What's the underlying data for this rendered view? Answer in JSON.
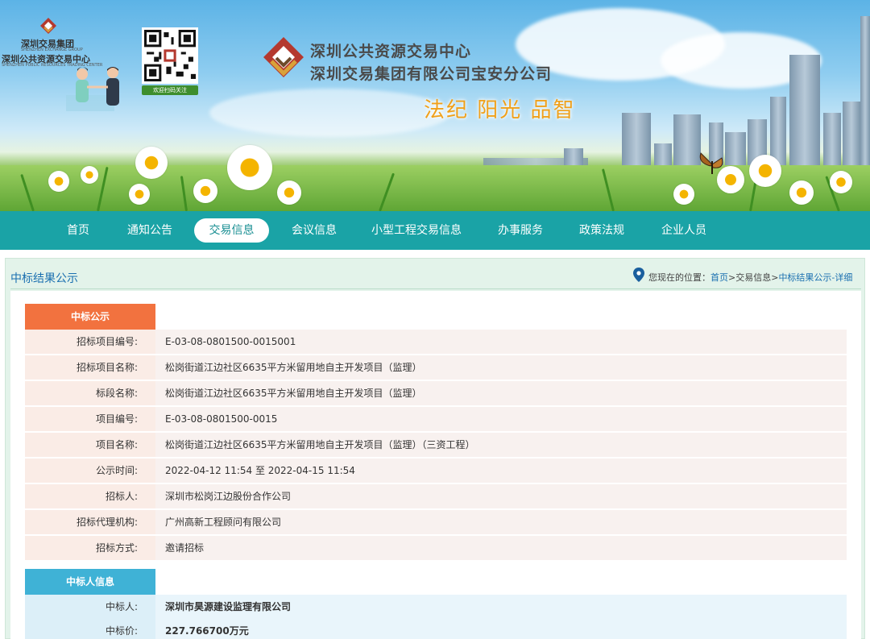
{
  "header": {
    "group_name": "深圳交易集团",
    "group_name_en": "SHENZHEN EXCHANGE GROUP",
    "center_name": "深圳公共资源交易中心",
    "center_name_en": "SHENZHEN PUBLIC RESOURCES TRADING CENTER",
    "qr_caption": "欢迎扫码关注",
    "org_line1": "深圳公共资源交易中心",
    "org_line2": "深圳交易集团有限公司宝安分公司",
    "slogan": "法纪  阳光  品智"
  },
  "nav": {
    "items": [
      {
        "label": "首页"
      },
      {
        "label": "通知公告"
      },
      {
        "label": "交易信息"
      },
      {
        "label": "会议信息"
      },
      {
        "label": "小型工程交易信息"
      },
      {
        "label": "办事服务"
      },
      {
        "label": "政策法规"
      },
      {
        "label": "企业人员"
      }
    ],
    "active": "交易信息"
  },
  "page": {
    "section_title": "中标结果公示",
    "location_prefix": "您现在的位置：",
    "crumb_home": "首页",
    "crumb_sep1": ">",
    "crumb_trade": "交易信息",
    "crumb_sep2": ">",
    "crumb_current": "中标结果公示-详细"
  },
  "announcement": {
    "tag": "中标公示",
    "rows": [
      {
        "label": "招标项目编号:",
        "value": "E-03-08-0801500-0015001"
      },
      {
        "label": "招标项目名称:",
        "value": "松岗街道江边社区6635平方米留用地自主开发项目（监理）"
      },
      {
        "label": "标段名称:",
        "value": "松岗街道江边社区6635平方米留用地自主开发项目（监理）"
      },
      {
        "label": "项目编号:",
        "value": "E-03-08-0801500-0015"
      },
      {
        "label": "项目名称:",
        "value": "松岗街道江边社区6635平方米留用地自主开发项目（监理）（三资工程）"
      },
      {
        "label": "公示时间:",
        "value": "2022-04-12 11:54 至 2022-04-15 11:54"
      },
      {
        "label": "招标人:",
        "value": "深圳市松岗江边股份合作公司"
      },
      {
        "label": "招标代理机构:",
        "value": "广州高新工程顾问有限公司"
      },
      {
        "label": "招标方式:",
        "value": "邀请招标"
      }
    ]
  },
  "winner": {
    "tag": "中标人信息",
    "rows": [
      {
        "label": "中标人:",
        "value": "深圳市昊源建设监理有限公司"
      },
      {
        "label": "中标价:",
        "value": "227.766700万元"
      }
    ]
  },
  "colors": {
    "nav_bg": "#1aa3a6",
    "tag_orange": "#f2723f",
    "tag_blue": "#3fb2d6",
    "link": "#1a6fb0",
    "slogan": "#f0a01a"
  }
}
